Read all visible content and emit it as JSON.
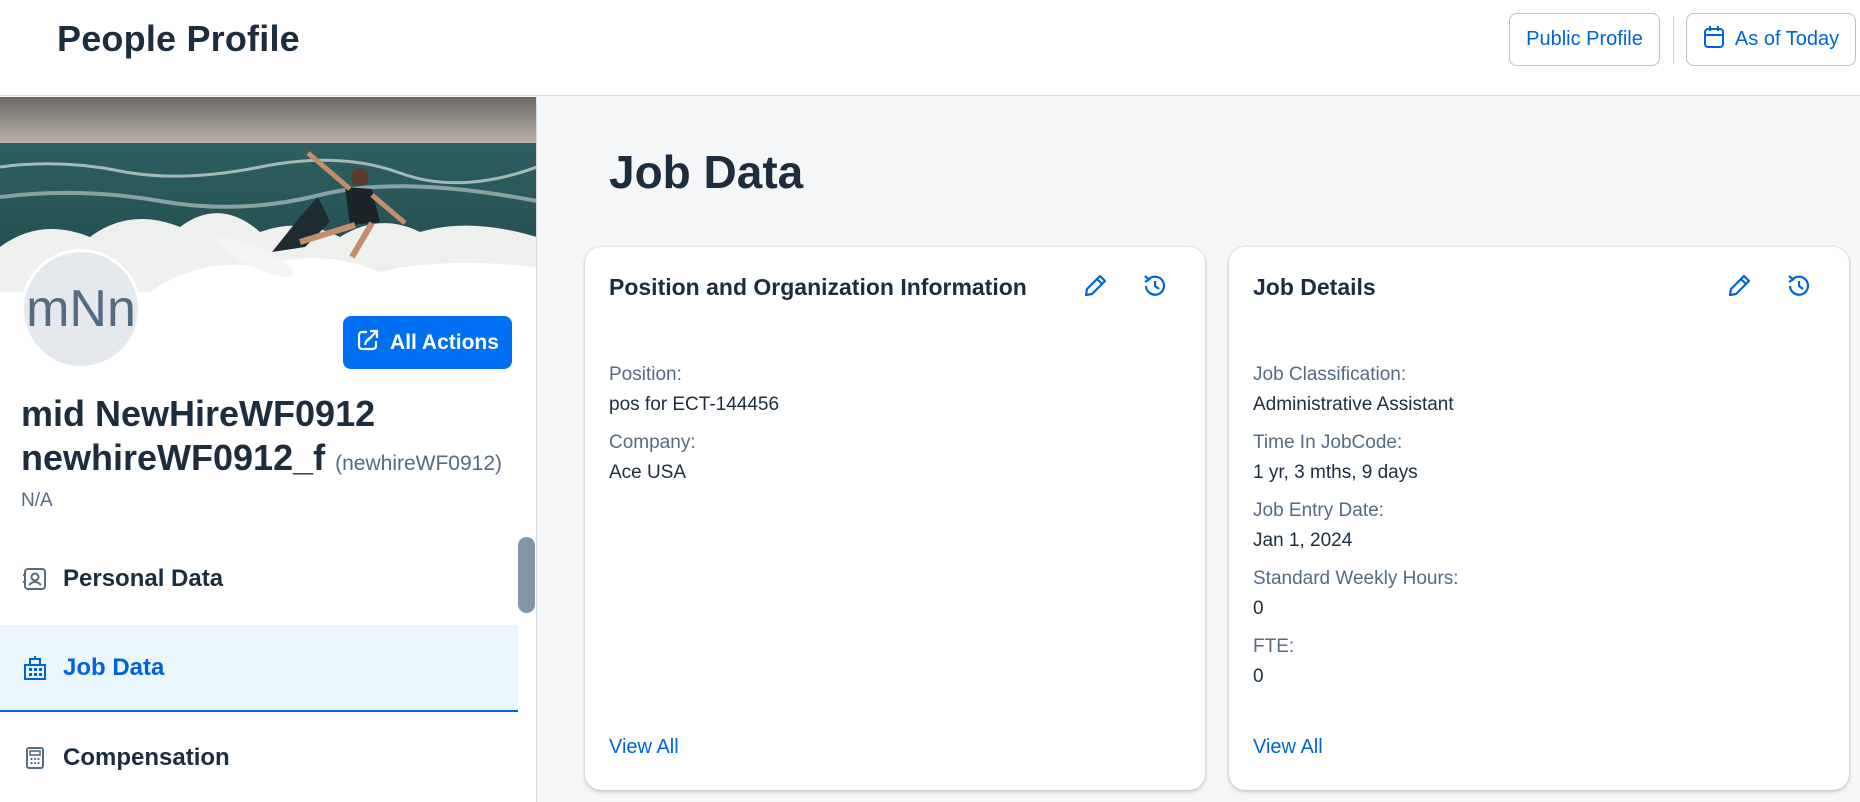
{
  "header": {
    "title": "People Profile",
    "public_profile_label": "Public Profile",
    "as_of_today_label": "As of Today"
  },
  "profile": {
    "avatar_initials": "mNn",
    "all_actions_label": "All Actions",
    "name": "mid NewHireWF0912 newhireWF0912_f",
    "username": "(newhireWF0912)",
    "subtitle": "N/A"
  },
  "nav": {
    "items": [
      {
        "label": "Personal Data",
        "icon": "contact-card-icon",
        "selected": false
      },
      {
        "label": "Job Data",
        "icon": "building-icon",
        "selected": true
      },
      {
        "label": "Compensation",
        "icon": "calculator-icon",
        "selected": false
      }
    ]
  },
  "main": {
    "title": "Job Data",
    "cards": [
      {
        "title": "Position and Organization Information",
        "fields": [
          {
            "label": "Position:",
            "value": "pos for ECT-144456"
          },
          {
            "label": "Company:",
            "value": "Ace USA"
          }
        ],
        "view_all": "View All"
      },
      {
        "title": "Job Details",
        "fields": [
          {
            "label": "Job Classification:",
            "value": "Administrative Assistant"
          },
          {
            "label": "Time In JobCode:",
            "value": "1 yr, 3 mths, 9 days"
          },
          {
            "label": "Job Entry Date:",
            "value": "Jan 1, 2024"
          },
          {
            "label": "Standard Weekly Hours:",
            "value": "0"
          },
          {
            "label": "FTE:",
            "value": "0"
          }
        ],
        "view_all": "View All"
      }
    ]
  },
  "colors": {
    "accent": "#0064d9",
    "primary_button": "#0070f2",
    "selected_nav_bg": "#eaf6fe",
    "text": "#1d2d3e",
    "label": "#556b82"
  }
}
